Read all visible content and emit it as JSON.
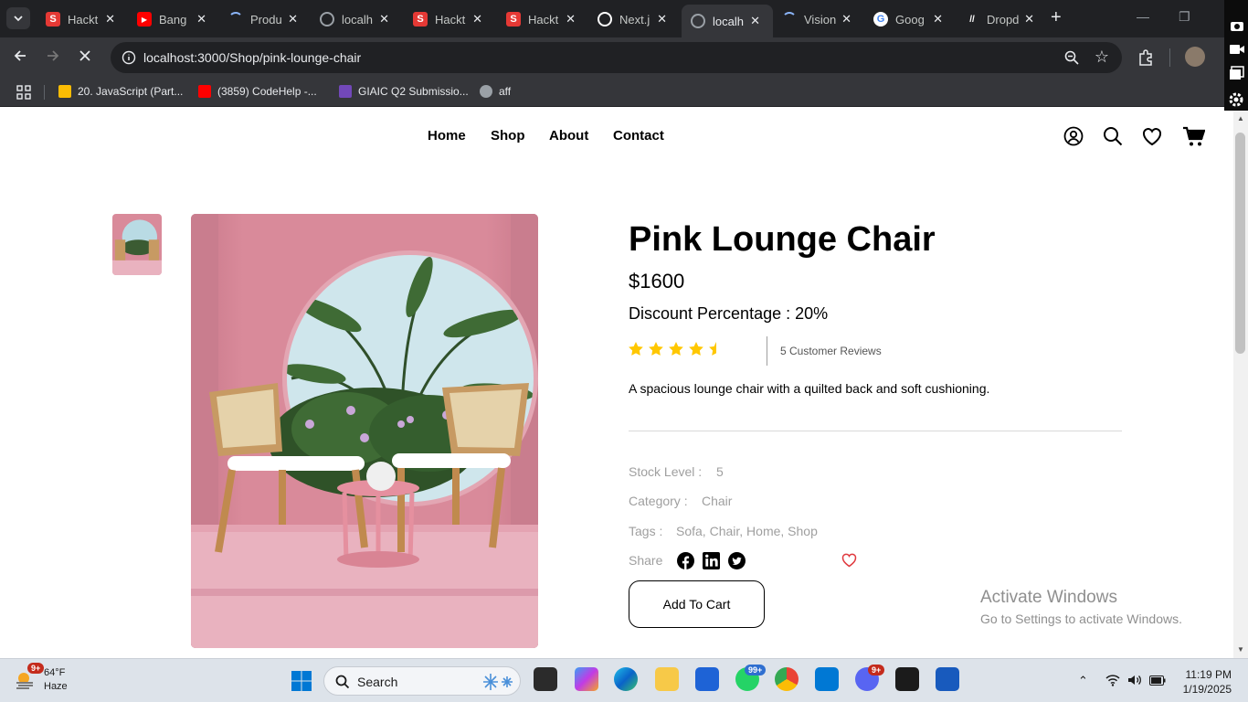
{
  "browser": {
    "tabs": [
      {
        "title": "Hackt",
        "icon": "s-logo-icon",
        "color": "#e53935"
      },
      {
        "title": "Bang",
        "icon": "youtube-icon",
        "color": "#ff0000"
      },
      {
        "title": "Produ",
        "icon": "loading-icon",
        "color": "#8ab4f8"
      },
      {
        "title": "localh",
        "icon": "globe-icon",
        "color": "#9aa0a6"
      },
      {
        "title": "Hackt",
        "icon": "s-logo-icon",
        "color": "#e53935"
      },
      {
        "title": "Hackt",
        "icon": "s-logo-icon",
        "color": "#e53935"
      },
      {
        "title": "Next.j",
        "icon": "openai-icon",
        "color": "#ffffff"
      },
      {
        "title": "localh",
        "icon": "globe-icon",
        "color": "#9aa0a6",
        "active": true
      },
      {
        "title": "Vision",
        "icon": "loading-icon",
        "color": "#8ab4f8"
      },
      {
        "title": "Goog",
        "icon": "google-icon",
        "color": "#4285f4"
      },
      {
        "title": "Dropd",
        "icon": "slash-icon",
        "color": "#ffffff"
      }
    ],
    "url": "localhost:3000/Shop/pink-lounge-chair",
    "bookmarks": [
      {
        "label": "20. JavaScript (Part...",
        "color": "#fbbc04"
      },
      {
        "label": "(3859) CodeHelp -...",
        "color": "#ff0000"
      },
      {
        "label": "GIAIC Q2 Submissio...",
        "color": "#7248b9"
      },
      {
        "label": "aff",
        "color": "#9aa0a6"
      }
    ]
  },
  "site": {
    "nav": [
      "Home",
      "Shop",
      "About",
      "Contact"
    ]
  },
  "product": {
    "name": "Pink Lounge Chair",
    "price": "$1600",
    "discount": "Discount Percentage : 20%",
    "rating": 4.5,
    "reviews": "5 Customer Reviews",
    "description": "A spacious lounge chair with a quilted back and soft cushioning.",
    "stock_label": "Stock Level :",
    "stock_value": "5",
    "category_label": "Category :",
    "category_value": "Chair",
    "tags_label": "Tags :",
    "tags_value": "Sofa, Chair, Home, Shop",
    "share_label": "Share",
    "cart_label": "Add To Cart"
  },
  "watermark": {
    "line1": "Activate Windows",
    "line2": "Go to Settings to activate Windows."
  },
  "taskbar": {
    "weather_temp": "64°F",
    "weather_desc": "Haze",
    "weather_badge": "9+",
    "search_label": "Search",
    "whatsapp_badge": "99+",
    "discord_badge": "9+",
    "time": "11:19 PM",
    "date": "1/19/2025"
  },
  "colors": {
    "star": "#ffc700",
    "wish": "#e0393e",
    "pink_wall": "#d98a9a"
  }
}
